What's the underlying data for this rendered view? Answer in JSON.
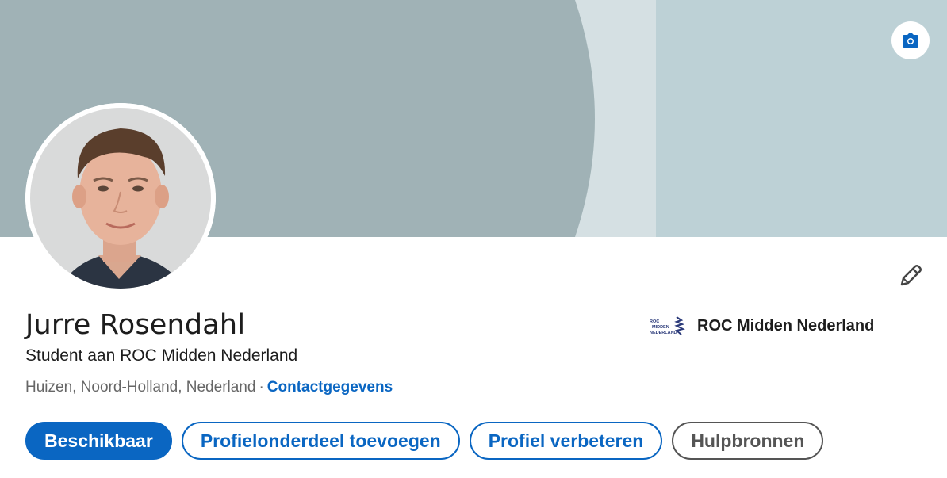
{
  "banner": {
    "colors": {
      "left": "#a0b2b6",
      "middle": "#d5e0e3",
      "right": "#bdd1d6"
    },
    "camera_icon": "camera-icon"
  },
  "profile": {
    "name": "Jurre Rosendahl",
    "headline": "Student aan ROC Midden Nederland",
    "location": "Huizen, Noord-Holland, Nederland",
    "separator": "·",
    "contact_link": "Contactgegevens",
    "edit_icon": "pencil-icon"
  },
  "organization": {
    "name": "ROC Midden Nederland",
    "logo_text": [
      "ROC",
      "MIDDEN",
      "NEDERLAND"
    ]
  },
  "actions": {
    "available": "Beschikbaar",
    "add_section": "Profielonderdeel toevoegen",
    "enhance": "Profiel verbeteren",
    "resources": "Hulpbronnen"
  },
  "colors": {
    "accent": "#0a66c2",
    "text": "#1d1d1d",
    "muted": "#666666"
  }
}
